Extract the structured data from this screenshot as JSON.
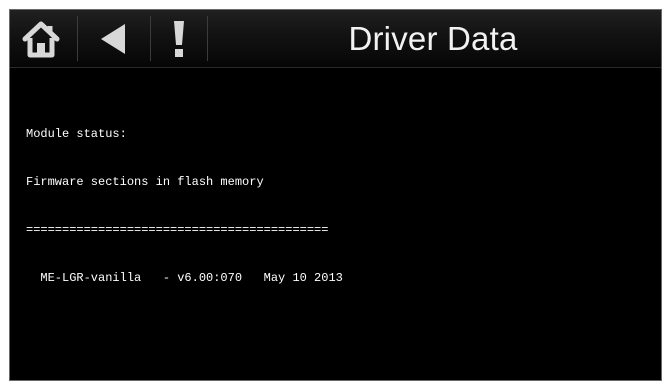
{
  "header": {
    "title": "Driver Data",
    "home_icon": "home-icon",
    "back_icon": "back-arrow-icon",
    "alert_icon": "exclamation-icon"
  },
  "status": {
    "lines": [
      "Module status:",
      "Firmware sections in flash memory",
      "==========================================",
      "  ME-LGR-vanilla   - v6.00:070   May 10 2013"
    ]
  },
  "colors": {
    "background": "#000000",
    "text": "#ffffff",
    "icon": "#d8d8d8"
  }
}
